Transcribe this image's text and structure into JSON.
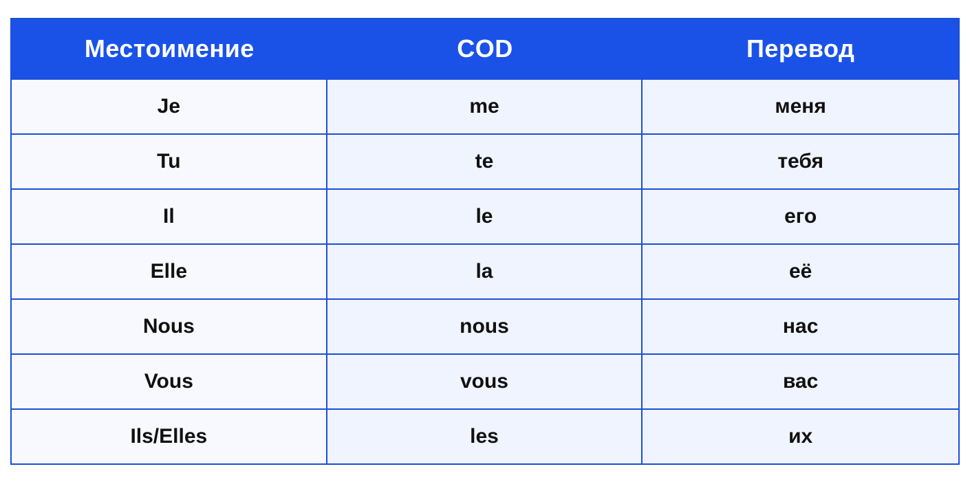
{
  "header": {
    "col1": "Местоимение",
    "col2": "COD",
    "col3": "Перевод"
  },
  "rows": [
    {
      "pronoun": "Je",
      "cod": "me",
      "translation": "меня"
    },
    {
      "pronoun": "Tu",
      "cod": "te",
      "translation": "тебя"
    },
    {
      "pronoun": "Il",
      "cod": "le",
      "translation": "его"
    },
    {
      "pronoun": "Elle",
      "cod": "la",
      "translation": "её"
    },
    {
      "pronoun": "Nous",
      "cod": "nous",
      "translation": "нас"
    },
    {
      "pronoun": "Vous",
      "cod": "vous",
      "translation": "вас"
    },
    {
      "pronoun": "Ils/Elles",
      "cod": "les",
      "translation": "их"
    }
  ]
}
